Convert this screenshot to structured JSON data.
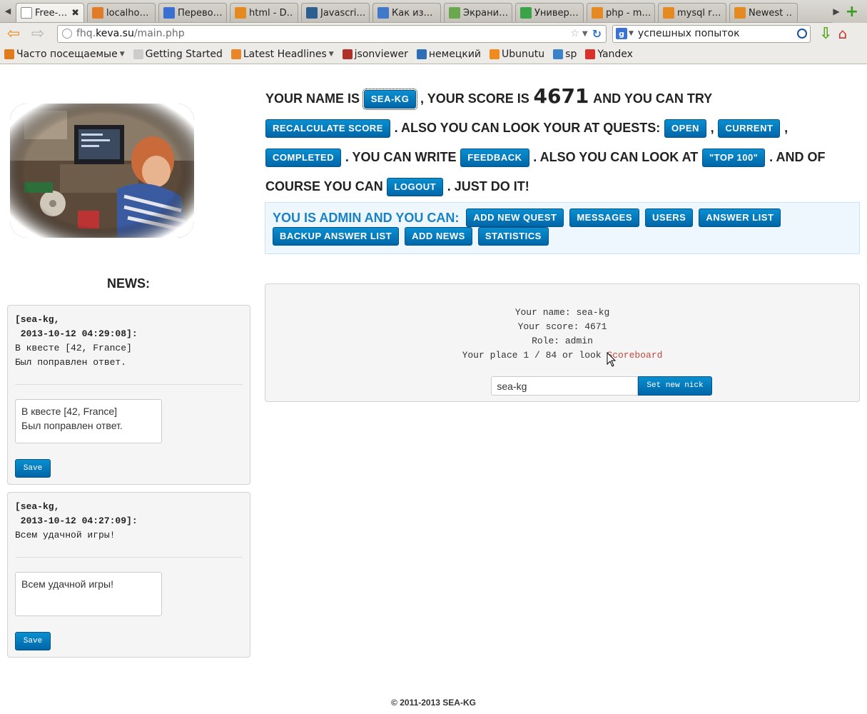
{
  "browser": {
    "tabs": [
      {
        "title": "Free-…",
        "active": true,
        "favicon": "blank-page-icon",
        "color": "#ffffff"
      },
      {
        "title": "localho…",
        "favicon": "pma-icon",
        "color": "#e17b26"
      },
      {
        "title": "Перево…",
        "favicon": "translate-icon",
        "color": "#3b6fd1"
      },
      {
        "title": "html - D…",
        "favicon": "stackoverflow-icon",
        "color": "#e58a23"
      },
      {
        "title": "Javascri…",
        "favicon": "t-icon",
        "color": "#2d5e92"
      },
      {
        "title": "Как из…",
        "favicon": "puzzle-icon",
        "color": "#3f79c8"
      },
      {
        "title": "Экрани…",
        "favicon": "p-icon",
        "color": "#6aa84f"
      },
      {
        "title": "Универ…",
        "favicon": "question-icon",
        "color": "#3aa34a"
      },
      {
        "title": "php - m…",
        "favicon": "stackoverflow-icon",
        "color": "#e58a23"
      },
      {
        "title": "mysql r…",
        "favicon": "stackoverflow-icon",
        "color": "#e58a23"
      },
      {
        "title": "Newest …",
        "favicon": "stackoverflow-icon",
        "color": "#e58a23"
      }
    ],
    "tab_close": "✖",
    "url_domain_prefix": "fhq.",
    "url_domain": "keva.su",
    "url_path": "/main.php",
    "search_value": "успешных попыток",
    "bookmarks": [
      {
        "label": "Часто посещаемые",
        "icon": "folder-icon",
        "color": "#e07a1c",
        "dropdown": true
      },
      {
        "label": "Getting Started",
        "icon": "page-icon",
        "color": "#cccccc",
        "dropdown": false
      },
      {
        "label": "Latest Headlines",
        "icon": "rss-icon",
        "color": "#e8862a",
        "dropdown": true
      },
      {
        "label": "jsonviewer",
        "icon": "opera-icon",
        "color": "#b0302a",
        "dropdown": false
      },
      {
        "label": "немецкий",
        "icon": "b-icon",
        "color": "#2f6db5",
        "dropdown": false
      },
      {
        "label": "Ubunutu",
        "icon": "blogger-icon",
        "color": "#f08a1c",
        "dropdown": false
      },
      {
        "label": "sp",
        "icon": "cart-icon",
        "color": "#3a83c9",
        "dropdown": false
      },
      {
        "label": "Yandex",
        "icon": "yandex-icon",
        "color": "#d9302b",
        "dropdown": false
      }
    ]
  },
  "intro": {
    "t1": "your name is",
    "name_btn": "sea-kg",
    "t2": ", your score is",
    "score": "4671",
    "t3": "and you can try",
    "recalc_btn": "recalculate score",
    "t4": ". also you can look your at quests:",
    "open_btn": "open",
    "comma1": ",",
    "current_btn": "current",
    "comma2": ",",
    "completed_btn": "completed",
    "t5": ". you can write",
    "feedback_btn": "feedback",
    "t6": ". also you can look at",
    "top_btn": "\"top 100\"",
    "t7": ". and of course you can",
    "logout_btn": "logout",
    "t8": ". just do it!"
  },
  "admin": {
    "label": "you is admin and you can:",
    "buttons": [
      "add new quest",
      "messages",
      "users",
      "answer list",
      "backup answer list",
      "add news",
      "statistics"
    ]
  },
  "news": {
    "heading": "news:",
    "items": [
      {
        "author": "[sea-kg,",
        "date": " 2013-10-12 04:29:08]:",
        "line1": "В квесте [42, France]",
        "line2": "Был поправлен ответ.",
        "edit": "В квесте [42, France]\nБыл поправлен ответ.",
        "save": "Save"
      },
      {
        "author": "[sea-kg,",
        "date": " 2013-10-12 04:27:09]:",
        "line1": "Всем удачной игры!",
        "line2": "",
        "edit": "Всем удачной игры!",
        "save": "Save"
      }
    ]
  },
  "info": {
    "name_line": "Your name: sea-kg",
    "score_line": "Your score: 4671",
    "role_line": "Role: admin",
    "place_prefix": "Your place 1 / 84 or look ",
    "scoreboard_link": "Scoreboard",
    "nick_value": "sea-kg",
    "set_nick_btn": "Set new nick"
  },
  "footer": "© 2011-2013 sea-kg"
}
